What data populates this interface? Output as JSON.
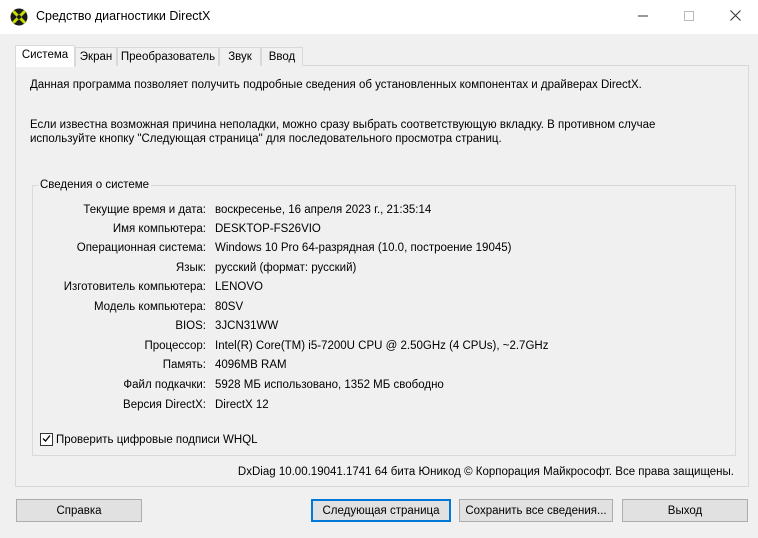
{
  "window": {
    "title": "Средство диагностики DirectX"
  },
  "tabs": [
    {
      "label": "Система"
    },
    {
      "label": "Экран"
    },
    {
      "label": "Преобразователь"
    },
    {
      "label": "Звук"
    },
    {
      "label": "Ввод"
    }
  ],
  "intro": {
    "line1": "Данная программа позволяет получить подробные сведения об установленных компонентах и драйверах DirectX.",
    "line2": "Если известна возможная причина неполадки, можно сразу выбрать соответствующую вкладку. В противном случае используйте кнопку \"Следующая страница\" для последовательного просмотра страниц."
  },
  "system_info": {
    "title": "Сведения о системе",
    "rows": [
      {
        "label": "Текущие время и дата:",
        "value": "воскресенье, 16 апреля 2023 г., 21:35:14"
      },
      {
        "label": "Имя компьютера:",
        "value": "DESKTOP-FS26VIO"
      },
      {
        "label": "Операционная система:",
        "value": "Windows 10 Pro 64-разрядная (10.0, построение 19045)"
      },
      {
        "label": "Язык:",
        "value": "русский (формат: русский)"
      },
      {
        "label": "Изготовитель компьютера:",
        "value": "LENOVO"
      },
      {
        "label": "Модель компьютера:",
        "value": "80SV"
      },
      {
        "label": "BIOS:",
        "value": "3JCN31WW"
      },
      {
        "label": "Процессор:",
        "value": "Intel(R) Core(TM) i5-7200U CPU @ 2.50GHz (4 CPUs), ~2.7GHz"
      },
      {
        "label": "Память:",
        "value": "4096MB RAM"
      },
      {
        "label": "Файл подкачки:",
        "value": "5928 МБ использовано, 1352 МБ свободно"
      },
      {
        "label": "Версия DirectX:",
        "value": "DirectX 12"
      }
    ]
  },
  "whql_checkbox": {
    "label": "Проверить цифровые подписи WHQL",
    "checked": true
  },
  "footer": "DxDiag 10.00.19041.1741 64 бита Юникод © Корпорация Майкрософт. Все права защищены.",
  "buttons": {
    "help": "Справка",
    "next_page": "Следующая страница",
    "save_all": "Сохранить все сведения...",
    "exit": "Выход"
  },
  "icons": {
    "app": "directx-icon",
    "minimize": "minimize-icon",
    "maximize": "maximize-icon",
    "close": "close-icon",
    "check": "check-icon"
  }
}
